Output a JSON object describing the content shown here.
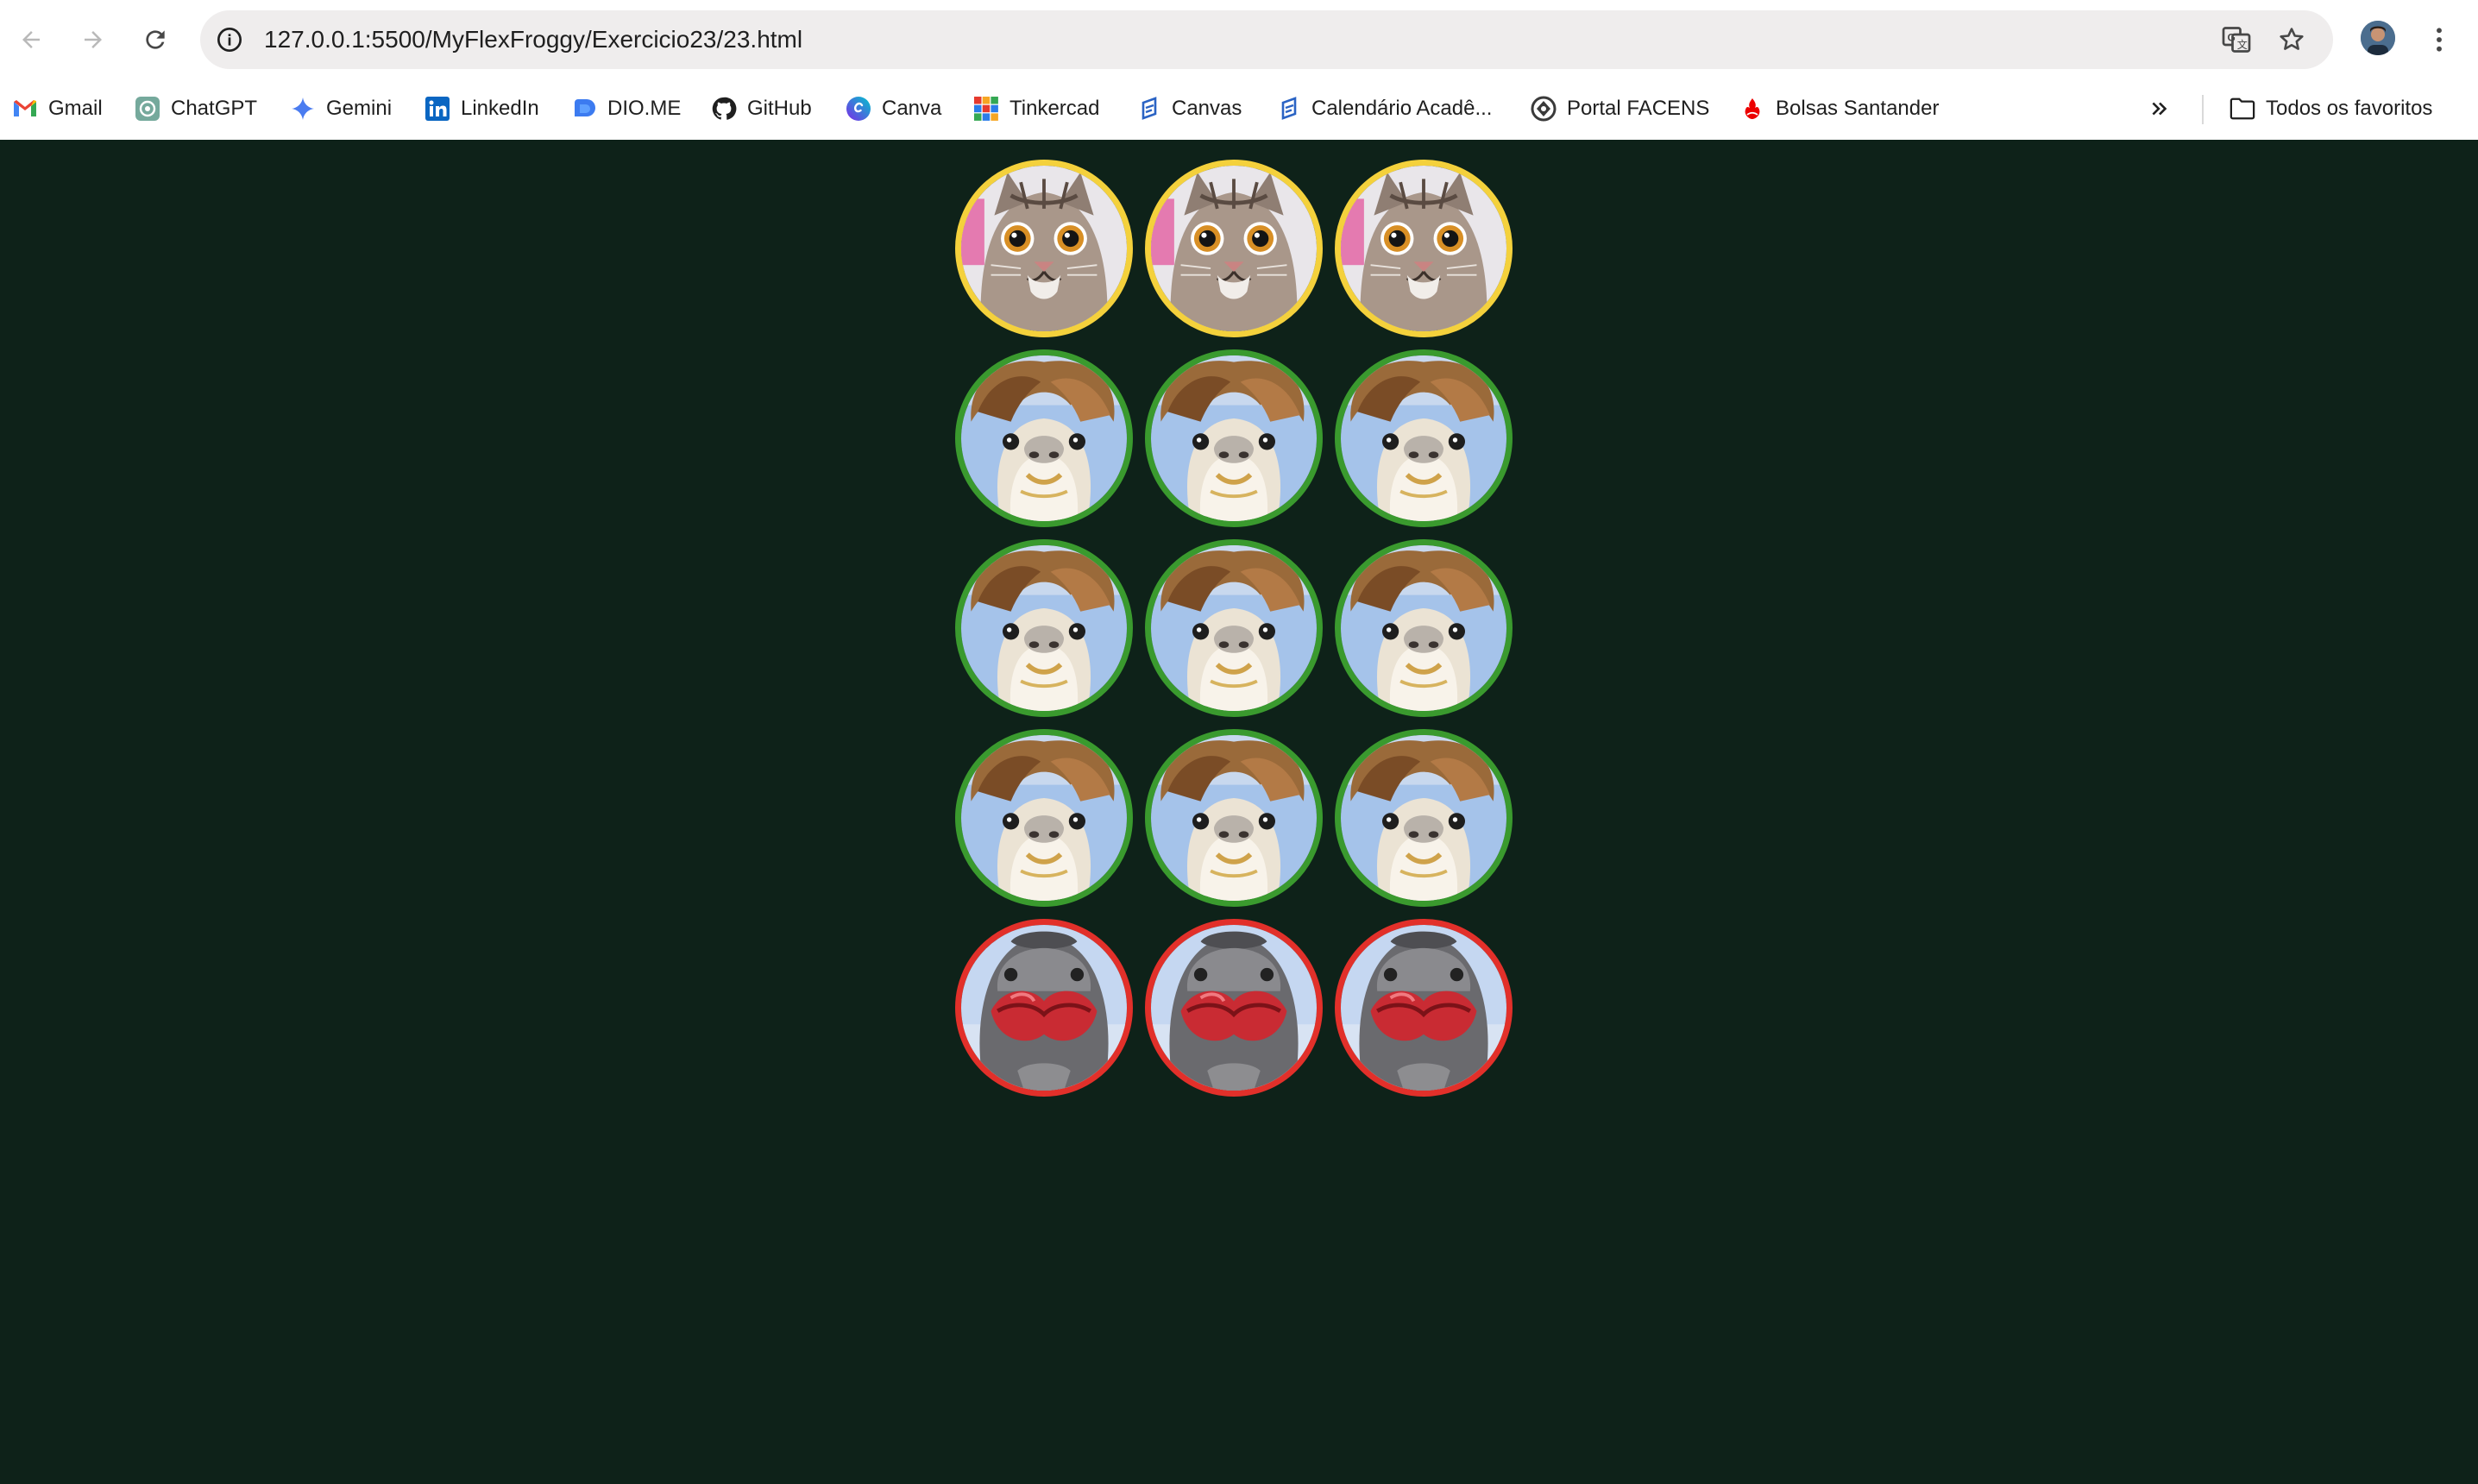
{
  "browser": {
    "url": "127.0.0.1:5500/MyFlexFroggy/Exercicio23/23.html",
    "bookmarks": [
      {
        "label": "Gmail",
        "icon": "gmail-icon"
      },
      {
        "label": "ChatGPT",
        "icon": "chatgpt-icon"
      },
      {
        "label": "Gemini",
        "icon": "gemini-icon"
      },
      {
        "label": "LinkedIn",
        "icon": "linkedin-icon"
      },
      {
        "label": "DIO.ME",
        "icon": "dio-icon"
      },
      {
        "label": "GitHub",
        "icon": "github-icon"
      },
      {
        "label": "Canva",
        "icon": "canva-icon"
      },
      {
        "label": "Tinkercad",
        "icon": "tinkercad-icon"
      },
      {
        "label": "Canvas",
        "icon": "canvas-icon"
      },
      {
        "label": "Calendário Acadê...",
        "icon": "canvas-icon"
      },
      {
        "label": "Portal FACENS",
        "icon": "facens-icon"
      },
      {
        "label": "Bolsas Santander",
        "icon": "santander-icon"
      }
    ],
    "all_bookmarks_label": "Todos os favoritos"
  },
  "page": {
    "background_color": "#0e2219",
    "grid": {
      "columns": 3,
      "rows": [
        {
          "animal": "cat",
          "ring_color": "#f4d13c",
          "count": 3
        },
        {
          "animal": "llama",
          "ring_color": "#3a9a2e",
          "count": 3
        },
        {
          "animal": "llama",
          "ring_color": "#3a9a2e",
          "count": 3
        },
        {
          "animal": "llama",
          "ring_color": "#3a9a2e",
          "count": 3
        },
        {
          "animal": "kiss",
          "ring_color": "#e2302a",
          "count": 3
        }
      ]
    }
  }
}
